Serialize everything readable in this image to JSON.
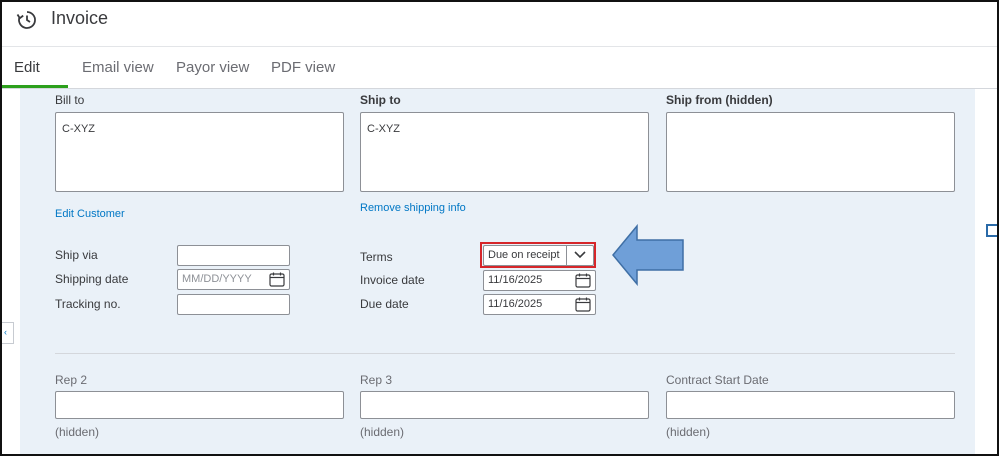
{
  "header": {
    "title": "Invoice"
  },
  "tabs": [
    {
      "label": "Edit"
    },
    {
      "label": "Email view"
    },
    {
      "label": "Payor view"
    },
    {
      "label": "PDF view"
    }
  ],
  "addresses": {
    "bill_to": {
      "label": "Bill to",
      "value": "C-XYZ",
      "link": "Edit Customer"
    },
    "ship_to": {
      "label": "Ship to",
      "value": "C-XYZ",
      "link": "Remove shipping info"
    },
    "ship_from": {
      "label": "Ship from (hidden)",
      "value": ""
    }
  },
  "shipping": {
    "ship_via": {
      "label": "Ship via",
      "value": ""
    },
    "shipping_date": {
      "label": "Shipping date",
      "placeholder": "MM/DD/YYYY"
    },
    "tracking_no": {
      "label": "Tracking no.",
      "value": ""
    }
  },
  "terms": {
    "terms": {
      "label": "Terms",
      "value": "Due on receipt"
    },
    "invoice_date": {
      "label": "Invoice date",
      "value": "11/16/2025"
    },
    "due_date": {
      "label": "Due date",
      "value": "11/16/2025"
    }
  },
  "custom_fields": [
    {
      "label": "Rep 2",
      "value": "",
      "note": "(hidden)"
    },
    {
      "label": "Rep 3",
      "value": "",
      "note": "(hidden)"
    },
    {
      "label": "Contract Start Date",
      "value": "",
      "note": "(hidden)"
    }
  ],
  "colors": {
    "accent": "#2ca01c",
    "link": "#0077c5",
    "panel_bg": "#eaf1f8",
    "highlight": "#d6262a",
    "annotation_arrow": "#6f9fd8"
  },
  "icons": {
    "history": "history-icon",
    "calendar": "calendar-icon",
    "dropdown": "chevron-down-icon",
    "annotation": "arrow-left-icon"
  }
}
